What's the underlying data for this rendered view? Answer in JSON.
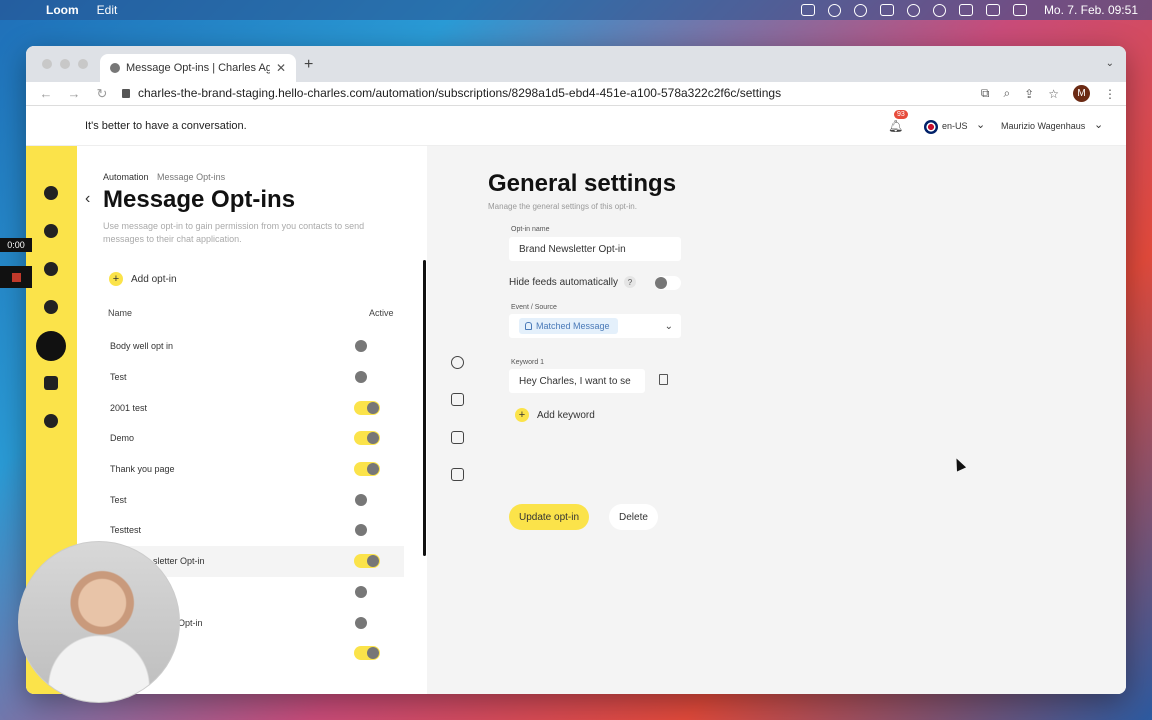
{
  "menubar": {
    "app": "Loom",
    "menu": "Edit",
    "clock": "Mo. 7. Feb. 09:51"
  },
  "browser": {
    "tab_title": "Message Opt-ins | Charles Age",
    "url": "charles-the-brand-staging.hello-charles.com/automation/subscriptions/8298a1d5-ebd4-451e-a100-578a322c2f6c/settings",
    "profile_initial": "M"
  },
  "header": {
    "tagline": "It's better to have a conversation.",
    "notification_count": "93",
    "language": "en-US",
    "user": "Maurizio Wagenhaus"
  },
  "left": {
    "breadcrumb_root": "Automation",
    "breadcrumb_current": "Message Opt-ins",
    "title": "Message Opt-ins",
    "description": "Use message opt-in to gain permission from you contacts to send messages to their chat application.",
    "add_label": "Add opt-in",
    "col_name": "Name",
    "col_active": "Active",
    "rows": [
      {
        "name": "Body well opt in",
        "active": false
      },
      {
        "name": "Test",
        "active": false
      },
      {
        "name": "2001 test",
        "active": true
      },
      {
        "name": "Demo",
        "active": true
      },
      {
        "name": "Thank you page",
        "active": true
      },
      {
        "name": "Test",
        "active": false
      },
      {
        "name": "Testtest",
        "active": false
      },
      {
        "name": "sletter Opt-in",
        "active": true
      },
      {
        "name": "",
        "active": false
      },
      {
        "name": "Opt-in",
        "active": false
      },
      {
        "name": "",
        "active": true
      }
    ]
  },
  "settings": {
    "title": "General settings",
    "subtitle": "Manage the general settings of this opt-in.",
    "optin_name_label": "Opt-in name",
    "optin_name_value": "Brand Newsletter Opt-in",
    "hide_feeds_label": "Hide feeds automatically",
    "hide_feeds_help": "?",
    "event_label": "Event / Source",
    "event_value": "Matched Message",
    "keyword_label": "Keyword 1",
    "keyword_value": "Hey Charles, I want to se",
    "add_keyword": "Add keyword",
    "update_button": "Update opt-in",
    "delete_button": "Delete"
  },
  "loom": {
    "timer": "0:00"
  },
  "colors": {
    "accent_yellow": "#fbe34a",
    "chip_blue": "#4a7ab8"
  }
}
